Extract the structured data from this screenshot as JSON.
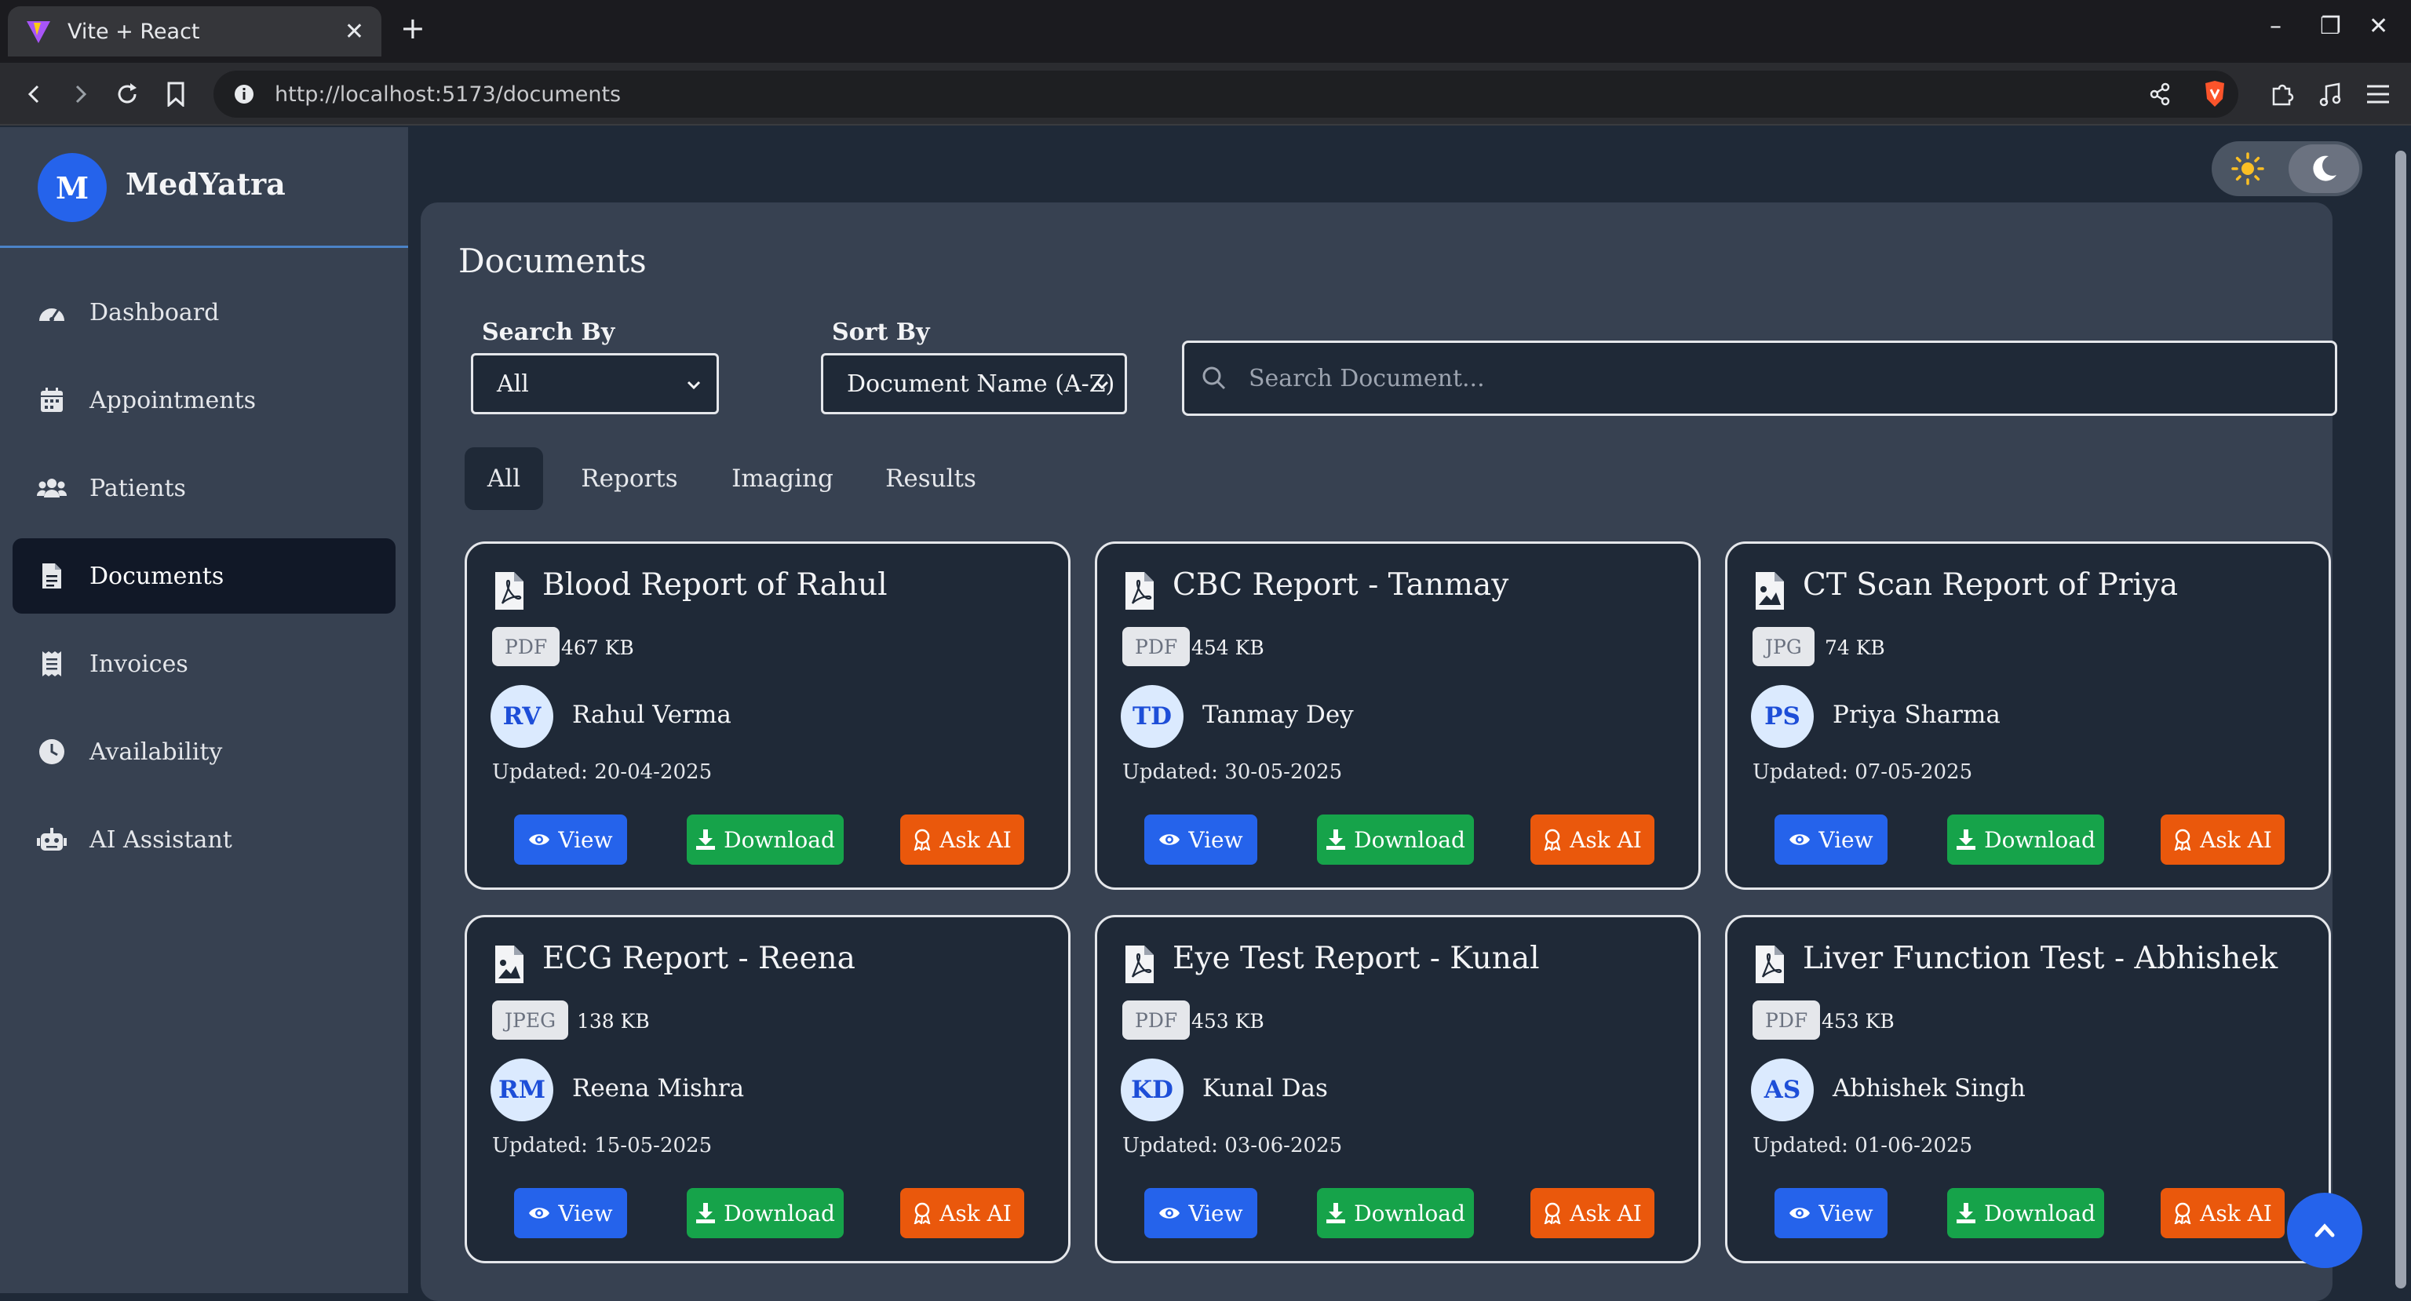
{
  "browser": {
    "tab_title": "Vite + React",
    "url": "http://localhost:5173/documents"
  },
  "sidebar": {
    "brand_initial": "M",
    "brand_name": "MedYatra",
    "items": [
      {
        "label": "Dashboard",
        "icon": "dashboard-icon"
      },
      {
        "label": "Appointments",
        "icon": "calendar-icon"
      },
      {
        "label": "Patients",
        "icon": "users-icon"
      },
      {
        "label": "Documents",
        "icon": "file-icon",
        "active": true
      },
      {
        "label": "Invoices",
        "icon": "receipt-icon"
      },
      {
        "label": "Availability",
        "icon": "clock-icon"
      },
      {
        "label": "AI Assistant",
        "icon": "robot-icon"
      }
    ]
  },
  "main": {
    "title": "Documents",
    "search_by_label": "Search By",
    "search_by_value": "All",
    "sort_by_label": "Sort By",
    "sort_by_value": "Document Name (A-Z)",
    "search_placeholder": "Search Document...",
    "tabs": [
      "All",
      "Reports",
      "Imaging",
      "Results"
    ],
    "active_tab": "All"
  },
  "buttons": {
    "view": "View",
    "download": "Download",
    "ask_ai": "Ask AI"
  },
  "documents": [
    {
      "title": "Blood Report of Rahul",
      "type": "PDF",
      "size": "467 KB",
      "initials": "RV",
      "patient": "Rahul Verma",
      "updated": "Updated: 20-04-2025",
      "icon": "pdf-file-icon"
    },
    {
      "title": "CBC Report - Tanmay",
      "type": "PDF",
      "size": "454 KB",
      "initials": "TD",
      "patient": "Tanmay Dey",
      "updated": "Updated: 30-05-2025",
      "icon": "pdf-file-icon"
    },
    {
      "title": "CT Scan Report of Priya",
      "type": "JPG",
      "size": "74 KB",
      "initials": "PS",
      "patient": "Priya Sharma",
      "updated": "Updated: 07-05-2025",
      "icon": "image-file-icon"
    },
    {
      "title": "ECG Report - Reena",
      "type": "JPEG",
      "size": "138 KB",
      "initials": "RM",
      "patient": "Reena Mishra",
      "updated": "Updated: 15-05-2025",
      "icon": "image-file-icon"
    },
    {
      "title": "Eye Test Report - Kunal",
      "type": "PDF",
      "size": "453 KB",
      "initials": "KD",
      "patient": "Kunal Das",
      "updated": "Updated: 03-06-2025",
      "icon": "pdf-file-icon"
    },
    {
      "title": "Liver Function Test - Abhishek",
      "type": "PDF",
      "size": "453 KB",
      "initials": "AS",
      "patient": "Abhishek Singh",
      "updated": "Updated: 01-06-2025",
      "icon": "pdf-file-icon"
    }
  ],
  "colors": {
    "view": "#2563eb",
    "download": "#16a34a",
    "ask_ai": "#ea580c",
    "accent": "#2563eb"
  }
}
